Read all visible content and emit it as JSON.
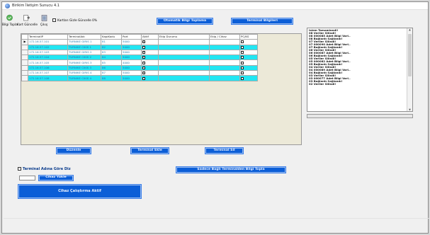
{
  "window": {
    "title": "Birikim İletişim Sunucu 4.1"
  },
  "toolbar": {
    "btn1_label": "Bilgi Topla",
    "btn2_label": "Kart Güncelle",
    "btn3_label": "Çıkış",
    "checkbox_label": "Kartları Gizle Güncelle 0%",
    "btn_collect_label": "Otomatik Bilgi Toplama",
    "btn_terminal_info_label": "Terminal Bilgileri"
  },
  "grid": {
    "headers": [
      "TerminalIP",
      "TerminalAdı",
      "KapıKodu",
      "Port",
      "Aktif",
      "Ekip Durumu",
      "Ekip / Cihaz",
      "PC/KS"
    ],
    "rows": [
      [
        "172.16.57.101",
        "TURNIKE GIRIS 1",
        "81",
        "5000"
      ],
      [
        "172.16.57.102",
        "TURNIKE CIKIS 1",
        "82",
        "5000"
      ],
      [
        "172.16.57.103",
        "TURNIKE GIRIS 2",
        "83",
        "5000"
      ],
      [
        "172.16.57.104",
        "TURNIKE CIKIS 2",
        "84",
        "5000"
      ],
      [
        "172.16.57.105",
        "TURNIKE GIRIS 3",
        "85",
        "4000"
      ],
      [
        "172.16.57.106",
        "TURNIKE CIKIS 3",
        "86",
        "5000"
      ],
      [
        "172.16.57.107",
        "TURNIKE GIRIS 4",
        "87",
        "5000"
      ],
      [
        "172.16.57.108",
        "TURNIKE CIKIS 4",
        "88",
        "5000"
      ]
    ]
  },
  "grid_buttons": {
    "edit_label": "Düzenle",
    "add_label": "Terminal Ekle",
    "delete_label": "Terminal Sil"
  },
  "log": {
    "lines": [
      "Islem Tamamlandi!",
      "08 Veriler Silindi!",
      "08 000085 Adet Bilgi Vari..",
      "08 Bağlantı Sağlandı!",
      "07 Veriler Silindi!",
      "07 000090 Adet Bilgi Vari..",
      "07 Bağlantı Sağlandı!",
      "06 Veriler Silindi!",
      "06 000087 Adet Bilgi Vari..",
      "06 Bağlantı Sağlandı!",
      "05 Veriler Silindi!",
      "05 000082 Adet Bilgi Vari..",
      "05 Bağlantı Sağlandı!",
      "04 Veriler Silindi!",
      "04 000089 Adet Bilgi Vari..",
      "04 Bağlantı Sağlandı!",
      "03 Veriler Silindi!",
      "03 000077 Adet Bilgi Vari..",
      "03 Bağlantı Sağlandı!",
      "02 Veriler Silindi!"
    ]
  },
  "bottom": {
    "checkbox_label": "Terminal Adına Göre Diz",
    "view_button_label": "Cihaz Yükle",
    "collect_connected_label": "Sadece Bağlı Terminalden Bilgi Topla",
    "big_button_label": "Cihaz Çalıştırma Aktif"
  },
  "colors": {
    "accent_blue": "#0b5ed7",
    "row_cyan": "#22e6f2"
  },
  "icons": {
    "window": "app-globe-icon",
    "collect": "collect-icon",
    "update": "update-card-icon",
    "exit": "exit-icon"
  }
}
